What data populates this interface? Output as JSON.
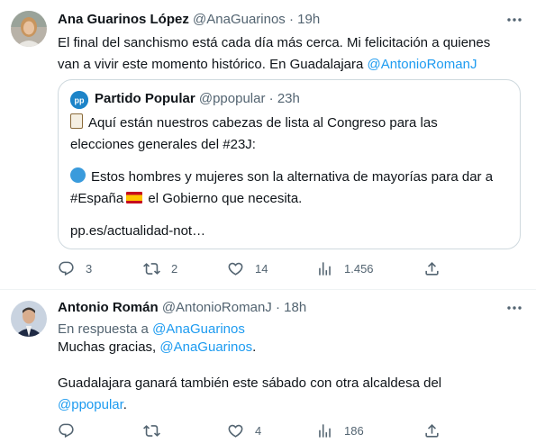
{
  "tweets": [
    {
      "author_name": "Ana Guarinos López",
      "handle": "@AnaGuarinos",
      "separator": "·",
      "time": "19h",
      "text_lines": [
        "El final del sanchismo está cada día más cerca. Mi felicitación a quienes",
        "van a vivir este momento histórico. En Guadalajara "
      ],
      "mention": "@AntonioRomanJ",
      "quote": {
        "author_name": "Partido Popular",
        "handle": "@ppopular",
        "separator": "·",
        "time": "23h",
        "line1": "Aquí están nuestros cabezas de lista al Congreso para las",
        "line2": "elecciones generales del #23J:",
        "line3": "Estos hombres y mujeres son la alternativa de mayorías para dar a",
        "line4_a": "#España",
        "line4_b": " el Gobierno que necesita.",
        "line5": "pp.es/actualidad-not…"
      },
      "actions": {
        "replies": "3",
        "retweets": "2",
        "likes": "14",
        "views": "1.456"
      }
    },
    {
      "author_name": "Antonio Román",
      "handle": "@AntonioRomanJ",
      "separator": "·",
      "time": "18h",
      "reply_prefix": "En respuesta a ",
      "reply_to": "@AnaGuarinos",
      "line1_a": "Muchas gracias, ",
      "line1_mention": "@AnaGuarinos",
      "line1_b": ".",
      "line2": "Guadalajara ganará también este sábado con otra alcaldesa del",
      "line3_mention": "@ppopular",
      "line3_b": ".",
      "actions": {
        "replies": "",
        "retweets": "",
        "likes": "4",
        "views": "186"
      }
    }
  ],
  "colors": {
    "link": "#1d9bf0",
    "muted": "#536471",
    "border": "#cfd9de"
  },
  "icons": [
    "more-icon",
    "reply-icon",
    "retweet-icon",
    "like-icon",
    "views-icon",
    "share-icon"
  ]
}
